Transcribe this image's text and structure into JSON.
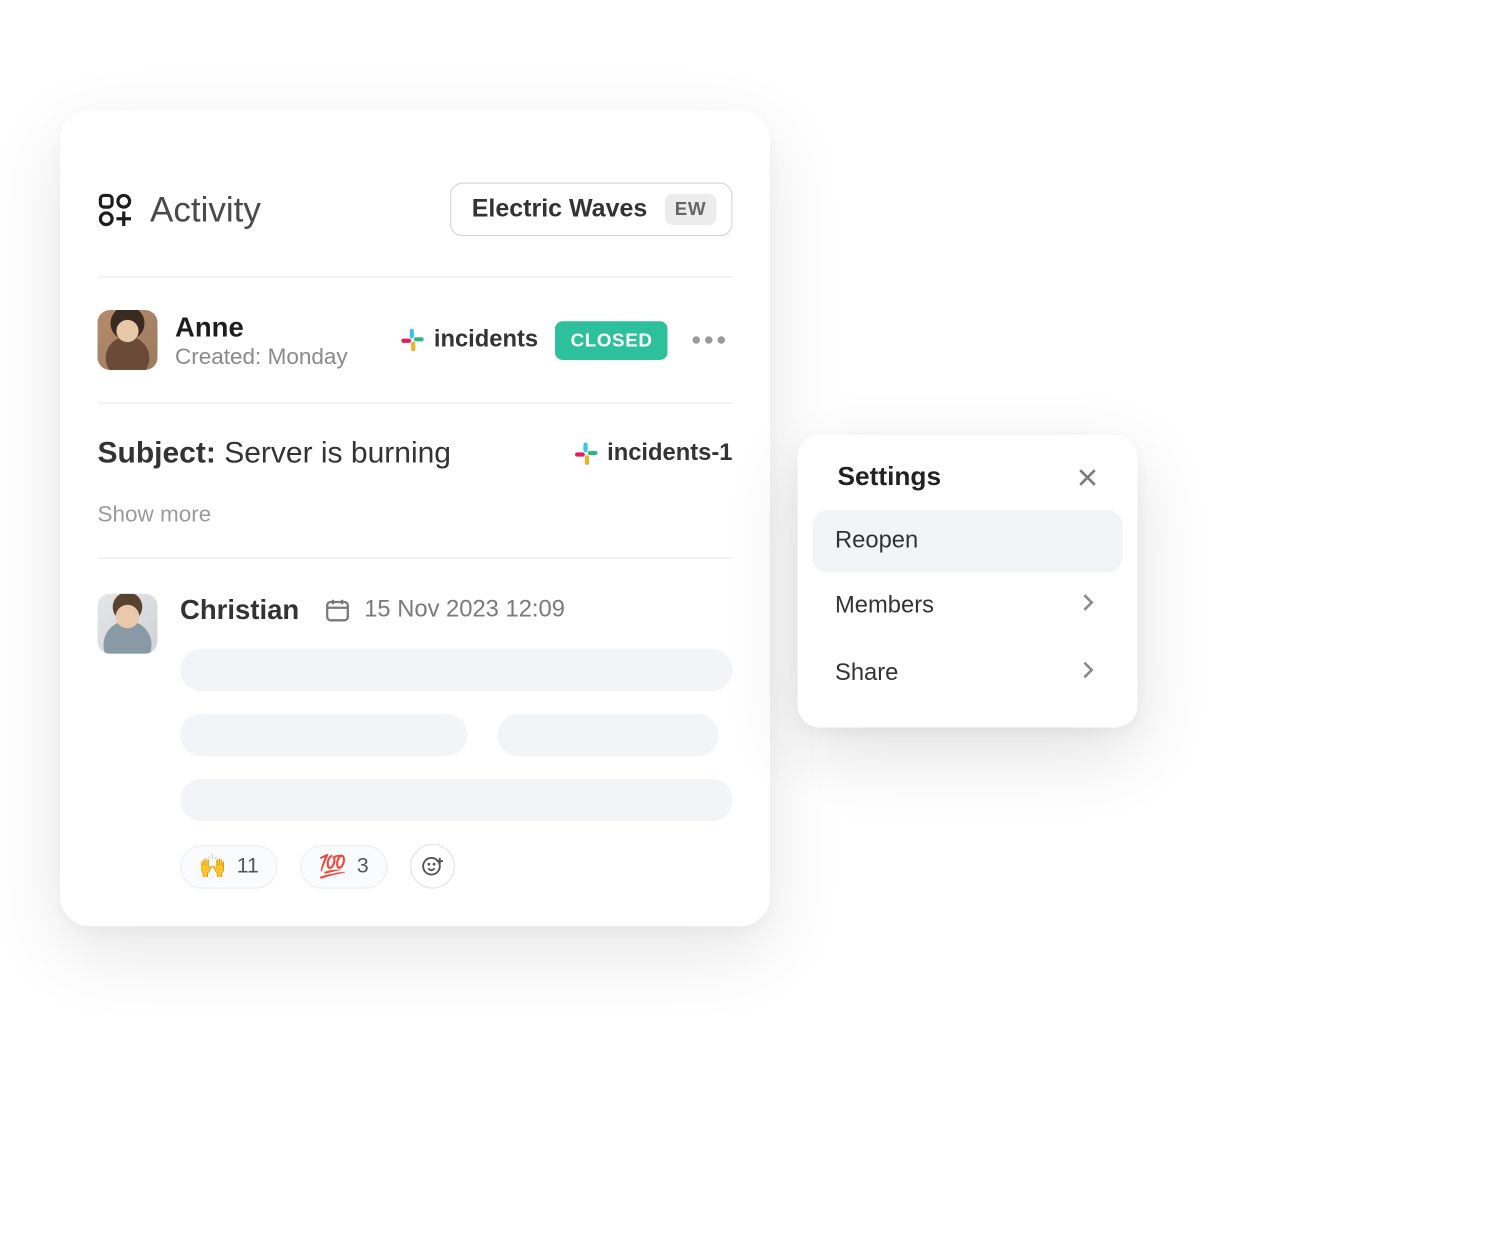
{
  "header": {
    "title": "Activity",
    "workspace": {
      "name": "Electric Waves",
      "badge": "EW"
    }
  },
  "incident": {
    "creator": {
      "name": "Anne"
    },
    "created_prefix": "Created:",
    "created_day": "Monday",
    "channel": "incidents",
    "status": "CLOSED"
  },
  "subject": {
    "label": "Subject:",
    "value": "Server is burning",
    "channel": "incidents-1",
    "show_more": "Show more"
  },
  "message": {
    "author": "Christian",
    "date": "15 Nov 2023 12:09",
    "reactions": [
      {
        "emoji": "🙌",
        "count": 11
      },
      {
        "emoji": "💯",
        "count": 3
      }
    ]
  },
  "settings": {
    "title": "Settings",
    "items": {
      "reopen": "Reopen",
      "members": "Members",
      "share": "Share"
    }
  }
}
